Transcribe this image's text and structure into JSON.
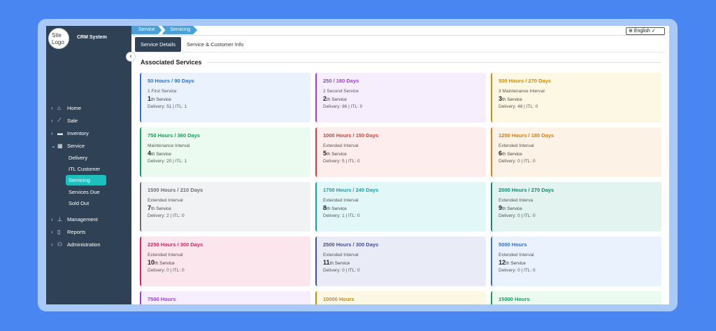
{
  "app": {
    "logo_alt": "Site Logo",
    "name": "CRM System",
    "collapse_glyph": "‹"
  },
  "colors": {
    "sidebar": "#2f4155",
    "active_sub": "#1ebfbf",
    "breadcrumb": "#4aa1d6"
  },
  "sidebar": {
    "items": [
      {
        "label": "Home",
        "icon": "home-icon"
      },
      {
        "label": "Sale",
        "icon": "chart-icon"
      },
      {
        "label": "Inventory",
        "icon": "car-icon"
      },
      {
        "label": "Service",
        "icon": "grid-icon",
        "expanded": true
      },
      {
        "label": "Management",
        "icon": "org-chart-icon"
      },
      {
        "label": "Reports",
        "icon": "document-icon"
      },
      {
        "label": "Administration",
        "icon": "users-gear-icon"
      }
    ],
    "service_sub": [
      "Delivery",
      "ITL Customer",
      "Servicing",
      "Services Due",
      "Sold Out"
    ],
    "active_sub": "Servicing"
  },
  "breadcrumb": [
    "Service",
    "Servicing"
  ],
  "language": "English ✓",
  "tabs": [
    "Service Details",
    "Service & Customer Info"
  ],
  "section_title": "Associated Services",
  "cards": [
    {
      "title": "50 Hours / 90 Days",
      "desc": "1 First Service",
      "num": "1",
      "suffix": "th Service",
      "meta": "Delivery: 51 | ITL: 1",
      "color": "#2f6fd6",
      "bg": "#eaf2fd"
    },
    {
      "title": "250 / 180 Days",
      "desc": "2 Second Service",
      "num": "2",
      "suffix": "th Service",
      "meta": "Delivery: 86 | ITL: 0",
      "color": "#9b3fd8",
      "bg": "#f7eefd"
    },
    {
      "title": "500 Hours / 270 Days",
      "desc": "3 Maintenance Interval",
      "num": "3",
      "suffix": "th Service",
      "meta": "Delivery: 48 | ITL: 0",
      "color": "#d68a0c",
      "bg": "#fdf8e4"
    },
    {
      "title": "750 Hours / 360 Days",
      "desc": "Maintenance Interval",
      "num": "4",
      "suffix": "th Service",
      "meta": "Delivery: 20 | ITL: 1",
      "color": "#16a05a",
      "bg": "#ebfbf0"
    },
    {
      "title": "1000 Hours / 150 Days",
      "desc": "Extended Interval",
      "num": "5",
      "suffix": "th Service",
      "meta": "Delivery: 5 | ITL: 0",
      "color": "#e0392f",
      "bg": "#fdeeed"
    },
    {
      "title": "1250 Hours / 180 Days",
      "desc": "Extended Interval",
      "num": "6",
      "suffix": "th Service",
      "meta": "Delivery: 0 | ITL: 0",
      "color": "#e07a12",
      "bg": "#fdf2e6"
    },
    {
      "title": "1500 Hours / 210 Days",
      "desc": "Extended Interval",
      "num": "7",
      "suffix": "th Service",
      "meta": "Delivery: 2 | ITL: 0",
      "color": "#6b6f76",
      "bg": "#f1f2f4"
    },
    {
      "title": "1750 Hours / 240 Days",
      "desc": "Extended Interval",
      "num": "8",
      "suffix": "th Service",
      "meta": "Delivery: 1 | ITL: 0",
      "color": "#12a3b3",
      "bg": "#e2f7f8"
    },
    {
      "title": "2000 Hours / 270 Days",
      "desc": "Extended Interva",
      "num": "9",
      "suffix": "th Service",
      "meta": "Delivery: 0 | ITL: 0",
      "color": "#0f8a73",
      "bg": "#e3f3ef"
    },
    {
      "title": "2250 Hours / 300 Days",
      "desc": "Extended Interval",
      "num": "10",
      "suffix": "th Service",
      "meta": "Delivery: 0 | ITL: 0",
      "color": "#d6245a",
      "bg": "#fce6ee"
    },
    {
      "title": "2500 Hours / 300 Days",
      "desc": "Extended Interval",
      "num": "11",
      "suffix": "th Service",
      "meta": "Delivery: 0 | ITL: 0",
      "color": "#3f4fb0",
      "bg": "#e9ebf6"
    },
    {
      "title": "5000 Hours",
      "desc": "Extended Interval",
      "num": "12",
      "suffix": "th Service",
      "meta": "Delivery: 0 | ITL: 0",
      "color": "#2f6fd6",
      "bg": "#eaf2fd"
    },
    {
      "title": "7500 Hours",
      "desc": "",
      "num": "",
      "suffix": "",
      "meta": "",
      "color": "#9b3fd8",
      "bg": "#f7eefd"
    },
    {
      "title": "10000 Hours",
      "desc": "",
      "num": "",
      "suffix": "",
      "meta": "",
      "color": "#d68a0c",
      "bg": "#fdf8e4"
    },
    {
      "title": "15000 Hours",
      "desc": "",
      "num": "",
      "suffix": "",
      "meta": "",
      "color": "#16a05a",
      "bg": "#ebfbf0"
    }
  ]
}
